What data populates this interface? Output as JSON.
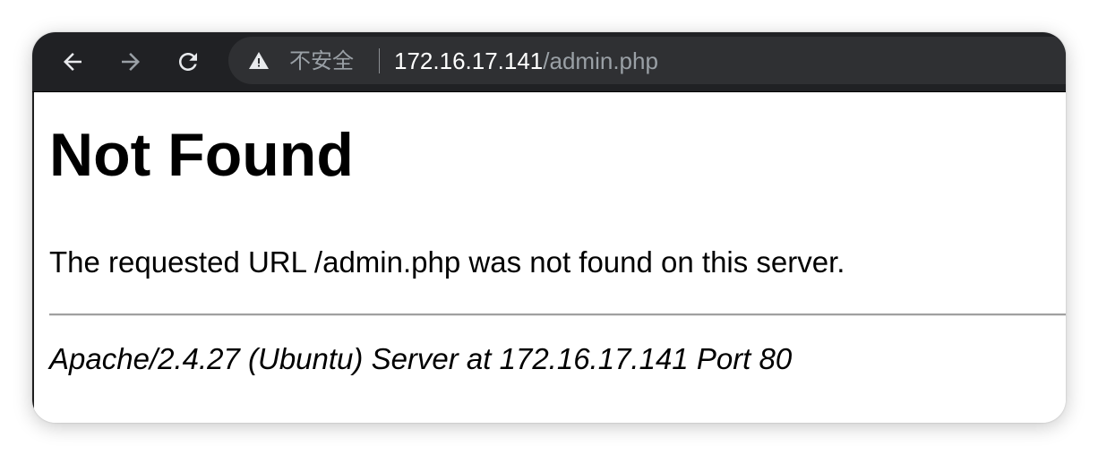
{
  "toolbar": {
    "back_icon": "arrow-left",
    "forward_icon": "arrow-right",
    "reload_icon": "reload",
    "colors": {
      "bar": "#202124",
      "omnibox": "#2f3033",
      "icon_active": "#e8eaed",
      "icon_disabled": "#9aa0a6"
    }
  },
  "address_bar": {
    "warning_icon": "warning-triangle",
    "security_label": "不安全",
    "url_host": "172.16.17.141",
    "url_path": "/admin.php"
  },
  "content": {
    "heading": "Not Found",
    "message": "The requested URL /admin.php was not found on this server.",
    "server_signature": "Apache/2.4.27 (Ubuntu) Server at 172.16.17.141 Port 80"
  }
}
